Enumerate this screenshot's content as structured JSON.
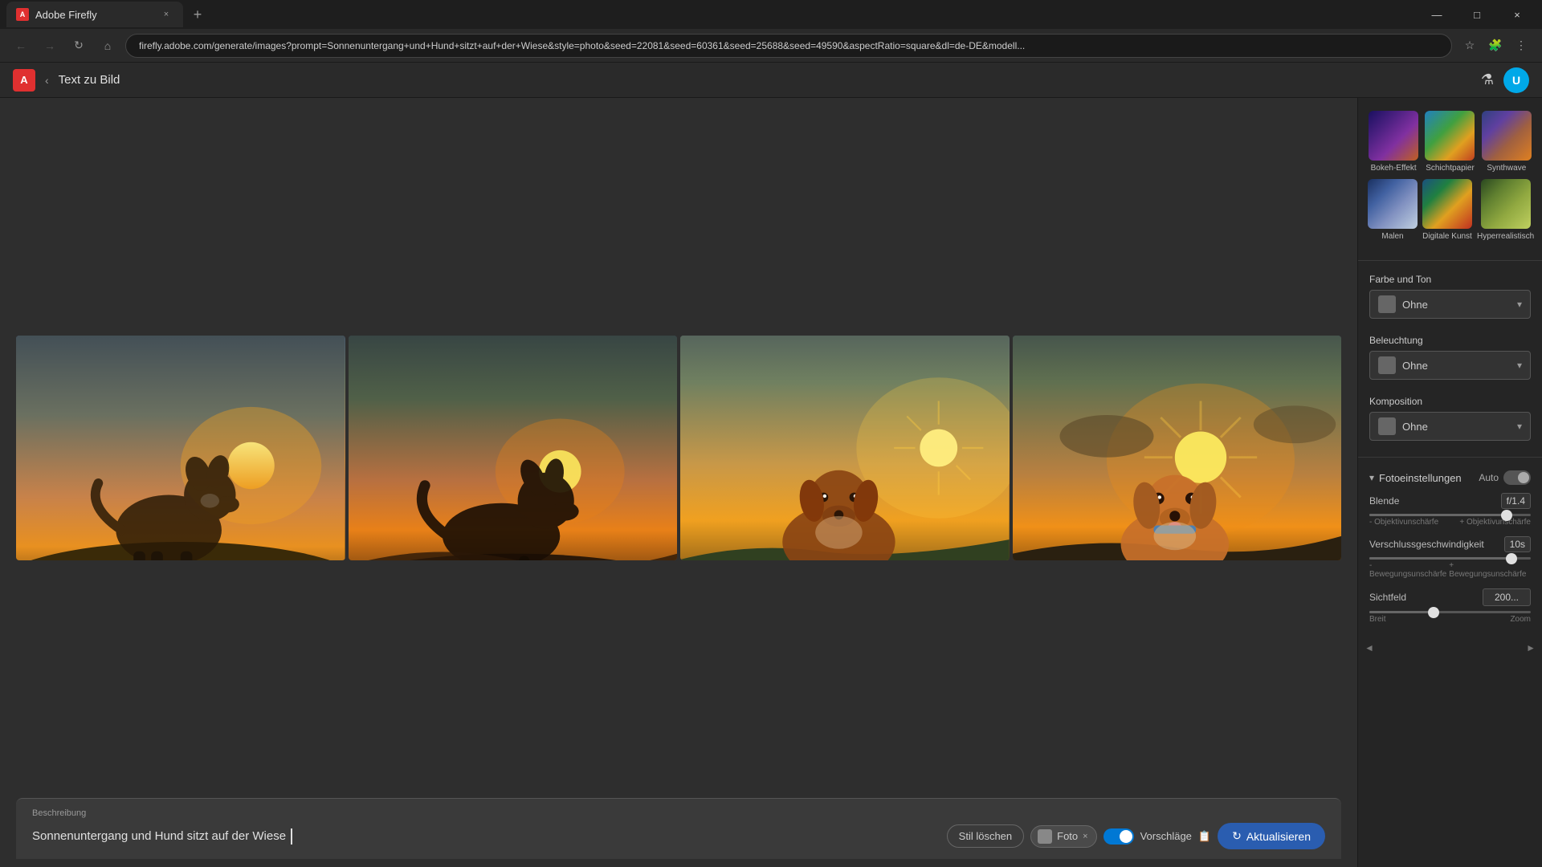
{
  "browser": {
    "tab_title": "Adobe Firefly",
    "tab_favicon": "A",
    "url": "firefly.adobe.com/generate/images?prompt=Sonnenuntergang+und+Hund+sitzt+auf+der+Wiese&style=photo&seed=22081&seed=60361&seed=25688&seed=49590&aspectRatio=square&dl=de-DE&modell...",
    "new_tab_label": "+",
    "minimize": "—",
    "maximize": "□",
    "close": "×"
  },
  "app": {
    "logo_letter": "A",
    "back_arrow": "‹",
    "page_title": "Text zu Bild",
    "flask_icon": "⚗",
    "user_initial": "U"
  },
  "styles": {
    "row1": [
      {
        "id": "bokeh",
        "label": "Bokeh-Effekt"
      },
      {
        "id": "schicht",
        "label": "Schichtpapier"
      },
      {
        "id": "synth",
        "label": "Synthwave"
      }
    ],
    "row2": [
      {
        "id": "malen",
        "label": "Malen"
      },
      {
        "id": "digital",
        "label": "Digitale Kunst"
      },
      {
        "id": "hyper",
        "label": "Hyperrealistisch"
      }
    ]
  },
  "panels": {
    "farbe_ton": {
      "label": "Farbe und Ton",
      "value": "Ohne"
    },
    "beleuchtung": {
      "label": "Beleuchtung",
      "value": "Ohne"
    },
    "komposition": {
      "label": "Komposition",
      "value": "Ohne"
    }
  },
  "foto_settings": {
    "section_title": "Fotoeinstellungen",
    "auto_label": "Auto",
    "blende": {
      "label": "Blende",
      "value": "f/1.4",
      "fill_percent": 85,
      "thumb_percent": 85,
      "label_left": "- Objektivunschärfe",
      "label_right": "+ Objektivunschärfe"
    },
    "verschluss": {
      "label": "Verschlussgeschwindigkeit",
      "value": "10s",
      "fill_percent": 88,
      "thumb_percent": 88,
      "label_left": "- Bewegungsunschärfe",
      "label_right": "+ Bewegungsunschärfe"
    },
    "sichtfeld": {
      "label": "Sichtfeld",
      "value": "200...",
      "fill_percent": 40,
      "thumb_percent": 40,
      "label_left": "Breit",
      "label_right": "Zoom"
    }
  },
  "prompt": {
    "label": "Beschreibung",
    "text": "Sonnenuntergang und Hund sitzt auf der Wiese",
    "clear_style_btn": "Stil löschen",
    "style_tag_label": "Foto",
    "suggestions_label": "Vorschläge",
    "update_btn": "Aktualisieren"
  }
}
